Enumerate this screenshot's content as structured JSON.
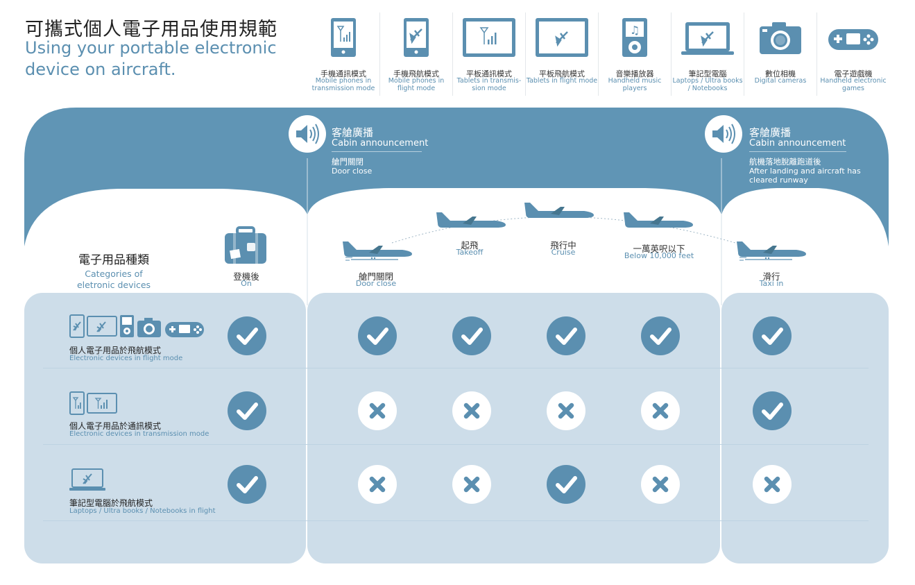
{
  "title": {
    "zh": "可攜式個人電子用品使用規範",
    "en": "Using your portable electronic device on aircraft."
  },
  "colors": {
    "accent": "#5b8fb0",
    "panel": "#cddde9",
    "band": "#6095b5"
  },
  "legend": [
    {
      "icon": "mobile-transmission-icon",
      "zh": "手機通訊模式",
      "en": "Mobile phones in transmission mode"
    },
    {
      "icon": "mobile-flight-icon",
      "zh": "手機飛航模式",
      "en": "Mobile phones in flight mode"
    },
    {
      "icon": "tablet-transmission-icon",
      "zh": "平板通訊模式",
      "en": "Tablets in transmis-sion mode"
    },
    {
      "icon": "tablet-flight-icon",
      "zh": "平板飛航模式",
      "en": "Tablets in flight mode"
    },
    {
      "icon": "music-player-icon",
      "zh": "音樂播放器",
      "en": "Handheld music players"
    },
    {
      "icon": "laptop-icon",
      "zh": "筆記型電腦",
      "en": "Laptops / Ultra books / Notebooks"
    },
    {
      "icon": "camera-icon",
      "zh": "數位相機",
      "en": "Digital cameras"
    },
    {
      "icon": "gamepad-icon",
      "zh": "電子遊戲機",
      "en": "Handheld electronic games"
    }
  ],
  "announcements": [
    {
      "title_zh": "客艙廣播",
      "title_en": "Cabin announcement",
      "event_zh": "艙門關閉",
      "event_en": "Door close"
    },
    {
      "title_zh": "客艙廣播",
      "title_en": "Cabin announcement",
      "event_zh": "航機落地脫離跑道後",
      "event_en": "After landing and aircraft has cleared runway"
    }
  ],
  "categories_header": {
    "zh": "電子用品種類",
    "en": "Categories of eletronic devices"
  },
  "phases": [
    {
      "zh": "登機後",
      "en": "On"
    },
    {
      "zh": "艙門關閉",
      "en": "Door close"
    },
    {
      "zh": "起飛",
      "en": "Takeoff"
    },
    {
      "zh": "飛行中",
      "en": "Cruise"
    },
    {
      "zh": "一萬英呎以下",
      "en": "Below 10,000 feet"
    },
    {
      "zh": "滑行",
      "en": "Taxi in"
    }
  ],
  "rows": [
    {
      "zh": "個人電子用品於飛航模式",
      "en": "Electronic devices in flight mode",
      "status": [
        true,
        true,
        true,
        true,
        true,
        true
      ]
    },
    {
      "zh": "個人電子用品於通訊模式",
      "en": "Electronic devices in transmission mode",
      "status": [
        true,
        false,
        false,
        false,
        false,
        true
      ]
    },
    {
      "zh": "筆記型電腦於飛航模式",
      "en": "Laptops / Ultra books / Notebooks in flight",
      "status": [
        true,
        false,
        false,
        true,
        false,
        false
      ]
    }
  ]
}
